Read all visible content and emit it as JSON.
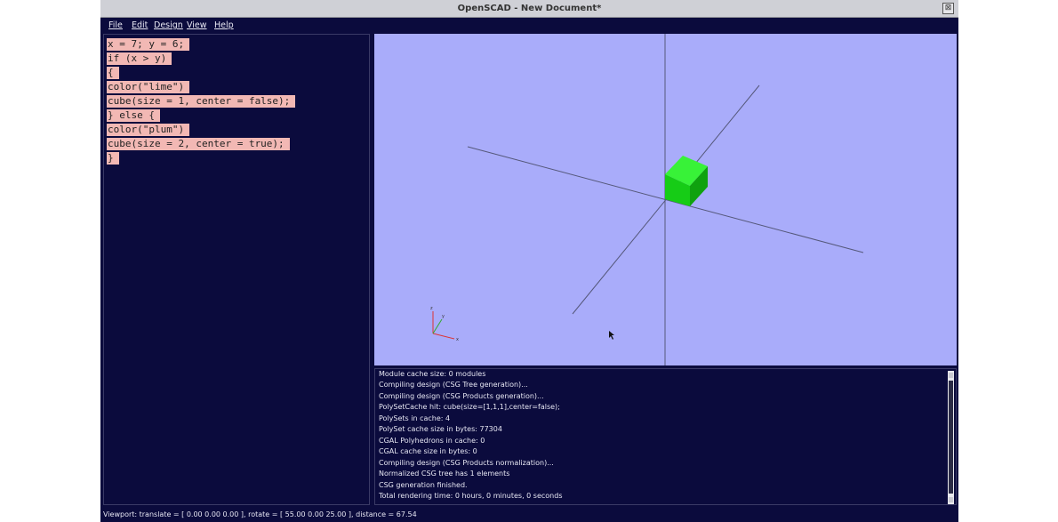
{
  "window": {
    "title": "OpenSCAD - New Document*",
    "close_glyph": "⊠"
  },
  "menu": [
    "File",
    "Edit",
    "Design",
    "View",
    "Help"
  ],
  "editor": {
    "lines": [
      "x = 7; y = 6;",
      "if (x > y)",
      "{",
      "color(\"lime\")",
      "cube(size = 1, center = false);",
      "} else {",
      "color(\"plum\")",
      "cube(size = 2, center = true);",
      "}"
    ]
  },
  "viewport": {
    "background": "#a9acfa",
    "cube_color": "#1bd21b",
    "axis_labels": {
      "z": "z",
      "y": "y",
      "x": "x"
    }
  },
  "console": {
    "lines": [
      "Module cache size: 0 modules",
      "Compiling design (CSG Tree generation)...",
      "Compiling design (CSG Products generation)...",
      "PolySetCache hit: cube(size=[1,1,1],center=false);",
      "PolySets in cache: 4",
      "PolySet cache size in bytes: 77304",
      "CGAL Polyhedrons in cache: 0",
      "CGAL cache size in bytes: 0",
      "Compiling design (CSG Products normalization)...",
      "Normalized CSG tree has 1 elements",
      "CSG generation finished.",
      "Total rendering time: 0 hours, 0 minutes, 0 seconds"
    ]
  },
  "statusbar": {
    "text": "Viewport: translate = [ 0.00 0.00 0.00 ], rotate = [ 55.00 0.00 25.00 ], distance = 67.54"
  }
}
